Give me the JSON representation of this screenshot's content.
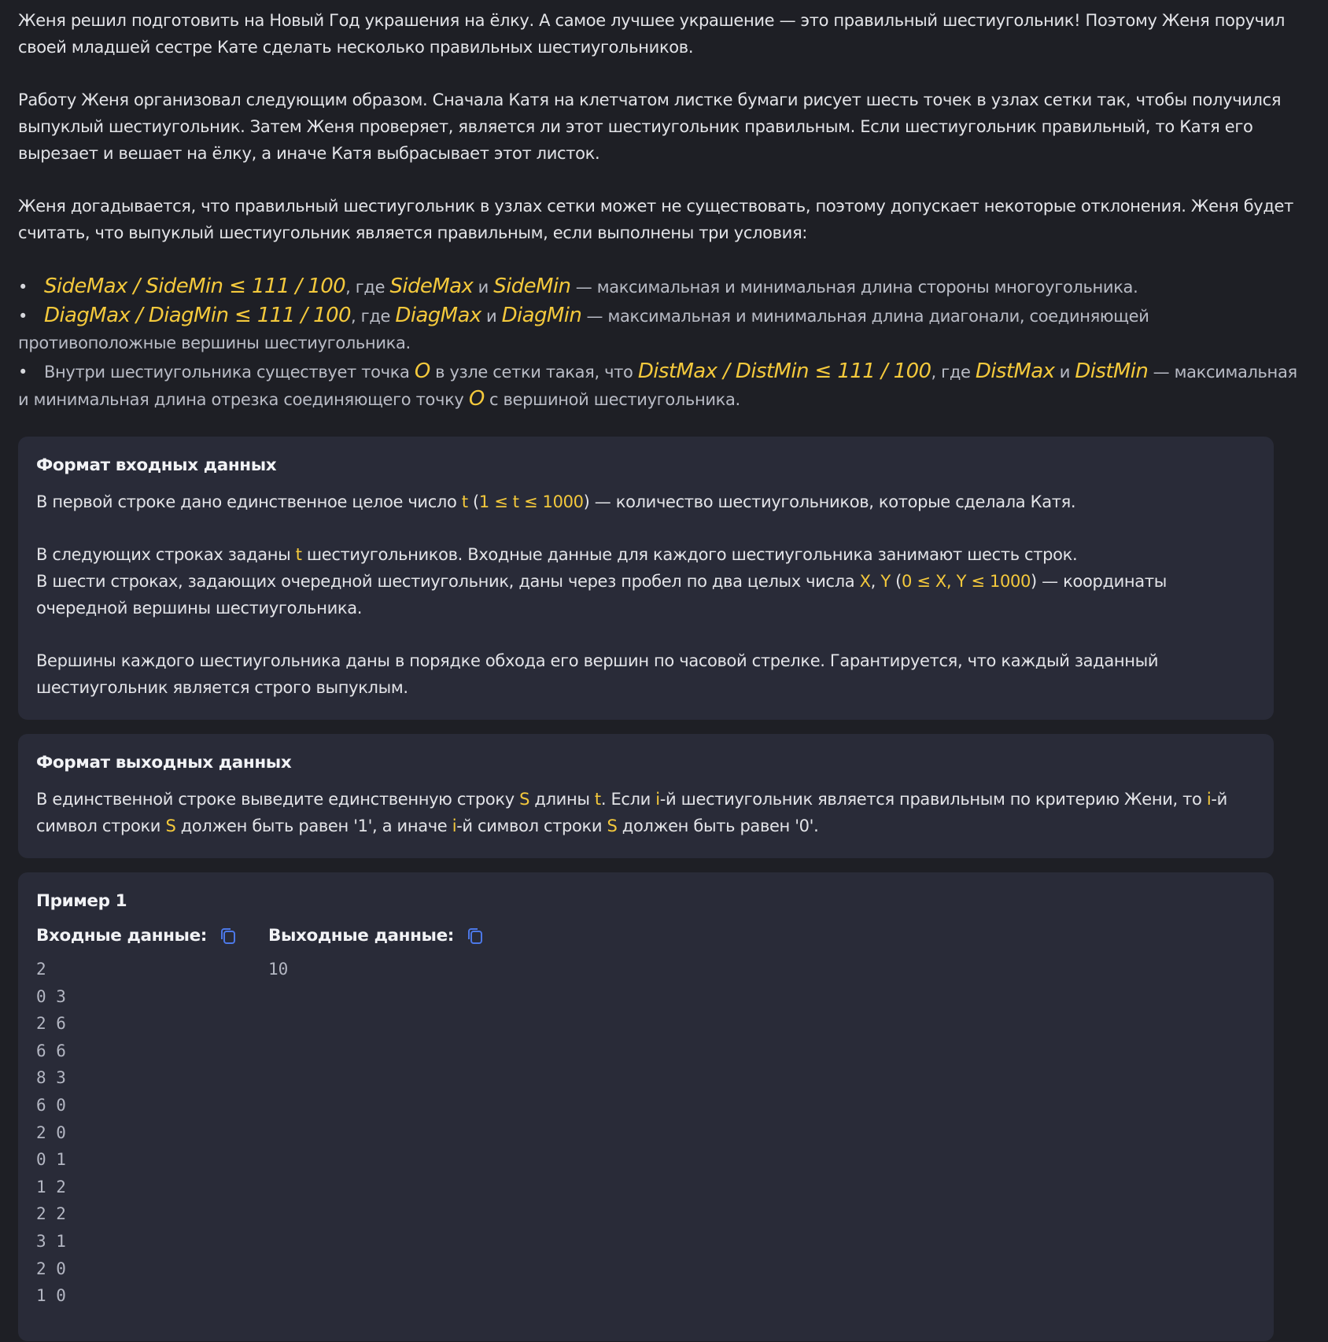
{
  "intro": {
    "p1": "Женя решил подготовить на Новый Год украшения на ёлку. А самое лучшее украшение — это правильный шестиугольник! Поэтому Женя поручил своей младшей сестре Кате сделать несколько правильных шестиугольников.",
    "p2": "Работу Женя организовал следующим образом. Сначала Катя на клетчатом листке бумаги рисует шесть точек в узлах сетки так, чтобы получился выпуклый шестиугольник. Затем Женя проверяет, является ли этот шестиугольник правильным. Если шестиугольник правильный, то Катя его вырезает и вешает на ёлку, а иначе Катя выбрасывает этот листок.",
    "p3": "Женя догадывается, что правильный шестиугольник в узлах сетки может не существовать, поэтому допускает некоторые отклонения. Женя будет считать, что выпуклый шестиугольник является правильным, если выполнены три условия:"
  },
  "conditions": {
    "bullet": "•",
    "c1": {
      "formula": "SideMax / SideMin ≤ 111 / 100",
      "gde": ", где ",
      "a": "SideMax",
      "and": " и ",
      "b": "SideMin",
      "rest": " — максимальная и минимальная длина стороны многоугольника."
    },
    "c2": {
      "formula": "DiagMax / DiagMin ≤ 111 / 100",
      "gde": ", где ",
      "a": "DiagMax",
      "and": " и ",
      "b": "DiagMin",
      "rest": " — максимальная и минимальная длина диагонали, соединяющей противоположные вершины шестиугольника."
    },
    "c3": {
      "pre": "Внутри шестиугольника существует точка ",
      "o": "O",
      "mid": " в узле сетки такая, что ",
      "formula": "DistMax / DistMin ≤ 111 / 100",
      "gde": ", где ",
      "a": "DistMax",
      "and": " и ",
      "b": "DistMin",
      "rest1": " — максимальная и минимальная длина отрезка соединяющего точку ",
      "o2": "O",
      "rest2": " с вершиной шестиугольника."
    }
  },
  "input_format": {
    "title": "Формат входных данных",
    "l1_pre": "В первой строке дано единственное целое число ",
    "l1_t": "t",
    "l1_open": " (",
    "l1_cond": "1 ≤ t ≤ 1000",
    "l1_post": ") — количество шестиугольников, которые сделала Катя.",
    "l2_pre": "В следующих строках заданы ",
    "l2_t": "t",
    "l2_post": " шестиугольников. Входные данные для каждого шестиугольника занимают шесть строк.",
    "l3_pre": "В шести строках, задающих очередной шестиугольник, даны через пробел по два целых числа ",
    "l3_x": "X",
    "l3_comma": ", ",
    "l3_y": "Y",
    "l3_open": " (",
    "l3_cond": "0 ≤ X, Y ≤ 1000",
    "l3_post": ") — координаты очередной вершины шестиугольника.",
    "l4": "Вершины каждого шестиугольника даны в порядке обхода его вершин по часовой стрелке. Гарантируется, что каждый заданный шестиугольник является строго выпуклым."
  },
  "output_format": {
    "title": "Формат выходных данных",
    "s1": "В единственной строке выведите единственную строку ",
    "S": "S",
    "s2": " длины ",
    "t": "t",
    "s3": ". Если ",
    "i": "i",
    "s4": "-й шестиугольник является правильным по критерию Жени, то ",
    "s5": "-й символ строки ",
    "s6": " должен быть равен '1', а иначе ",
    "s7": " должен быть равен '0'."
  },
  "example": {
    "title": "Пример 1",
    "input_label": "Входные данные:",
    "output_label": "Выходные данные:",
    "input_text": "2\n0 3\n2 6\n6 6\n8 3\n6 0\n2 0\n0 1\n1 2\n2 2\n3 1\n2 0\n1 0",
    "output_text": "10",
    "icon_color": "#4c78e8"
  }
}
